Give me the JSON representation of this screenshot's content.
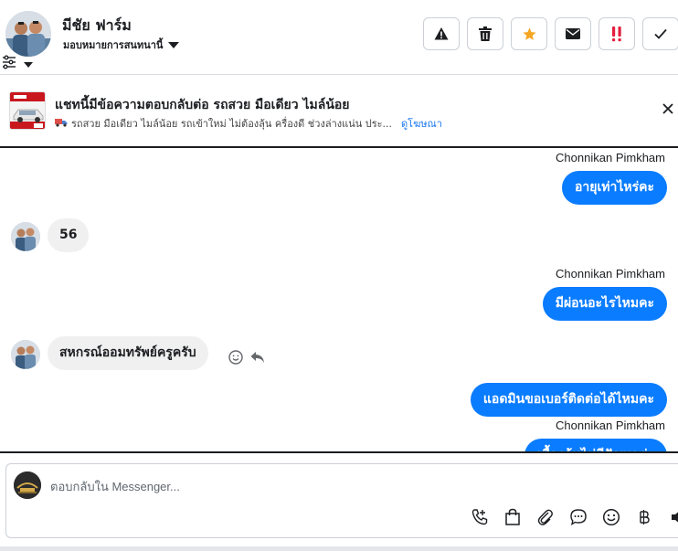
{
  "header": {
    "contact_name": "มีชัย ฟาร์ม",
    "assign_label": "มอบหมายการสนทนานี้",
    "actions": [
      {
        "name": "report-spam-button",
        "icon": "warning-icon"
      },
      {
        "name": "delete-button",
        "icon": "trash-icon"
      },
      {
        "name": "star-button",
        "icon": "star-icon"
      },
      {
        "name": "mark-unread-button",
        "icon": "envelope-icon"
      },
      {
        "name": "flag-priority-button",
        "icon": "priority-icon"
      },
      {
        "name": "mark-done-button",
        "icon": "check-icon"
      }
    ]
  },
  "ad": {
    "title": "แชทนี้มีข้อความตอบกลับต่อ รถสวย มือเดียว ไมล์น้อย",
    "subtitle": "รถสวย มือเดียว ไมล์น้อย รถเข้าใหม่ ไม่ต้องลุ้น ครื่องดี ช่วงล่างแน่น ประ...",
    "link": "ดูโฆษณา"
  },
  "messages": [
    {
      "sender": "Chonnikan Pimkham",
      "text": "อายุเท่าไหร่คะ"
    },
    {
      "text": "56"
    },
    {
      "sender": "Chonnikan Pimkham",
      "text": "มีผ่อนอะไรไหมคะ"
    },
    {
      "text": "สหกรณ์ออมทรัพย์ครูครับ"
    },
    {
      "text": "แอดมินขอเบอร์ติดต่อได้ไหมคะ"
    },
    {
      "sender": "Chonnikan Pimkham",
      "text": "เบื้องต้นไม่มีปัญหาค่ะ"
    }
  ],
  "composer": {
    "placeholder": "ตอบกลับใน Messenger..."
  },
  "colors": {
    "accent": "#0a7cff",
    "star": "#f5a623",
    "priority": "#e41e3f"
  }
}
